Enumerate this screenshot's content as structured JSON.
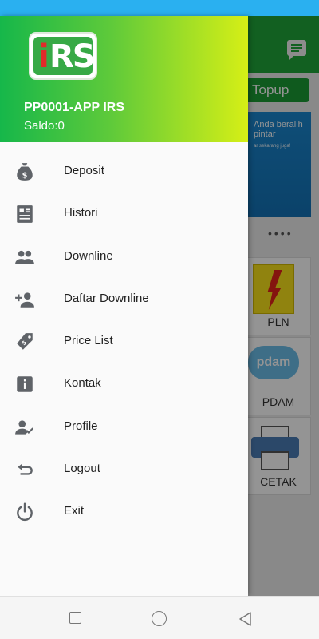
{
  "background_app": {
    "topup_label": "Topup",
    "banner_text": "Anda beralih pintar",
    "banner_small": "ar sekarang juga!",
    "tiles": [
      {
        "label": "PLN"
      },
      {
        "label": "PDAM",
        "logo_text": "pdam"
      },
      {
        "label": "CETAK"
      }
    ]
  },
  "drawer": {
    "logo_text": "IRS",
    "account_name": "PP0001-APP IRS",
    "balance": "Saldo:0",
    "menu": [
      {
        "label": "Deposit",
        "icon": "money-bag-icon"
      },
      {
        "label": "Histori",
        "icon": "receipt-icon"
      },
      {
        "label": "Downline",
        "icon": "people-icon"
      },
      {
        "label": "Daftar Downline",
        "icon": "person-add-icon"
      },
      {
        "label": "Price List",
        "icon": "price-tag-icon"
      },
      {
        "label": "Kontak",
        "icon": "info-icon"
      },
      {
        "label": "Profile",
        "icon": "person-check-icon"
      },
      {
        "label": "Logout",
        "icon": "undo-arrow-icon"
      },
      {
        "label": "Exit",
        "icon": "power-icon"
      }
    ]
  },
  "colors": {
    "header_gradient_start": "#16b74a",
    "header_gradient_end": "#d6ef16",
    "status_bar": "#2ab0f0",
    "toolbar": "#1fa53a",
    "icon": "#5f6368"
  }
}
